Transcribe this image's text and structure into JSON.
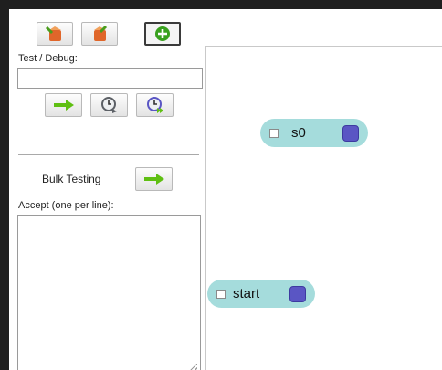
{
  "toolbar": {
    "buttons": [
      {
        "name": "save-file-icon",
        "color": "#e0662a"
      },
      {
        "name": "open-file-icon",
        "color": "#e0662a"
      },
      {
        "name": "add-state-icon",
        "color": "#39a11e"
      }
    ]
  },
  "debug": {
    "label": "Test / Debug:",
    "input_value": "",
    "buttons": [
      "run-arrow-icon",
      "step-clock-icon",
      "fast-forward-clock-icon"
    ]
  },
  "bulk": {
    "label": "Bulk Testing",
    "accept_label": "Accept (one per line):",
    "accept_value": ""
  },
  "states": [
    {
      "label": "s0",
      "checked": false
    },
    {
      "label": "start",
      "checked": false
    }
  ],
  "colors": {
    "state_fill": "#a5dcdc",
    "state_handle": "#5a56c4",
    "arrow_green": "#5fbf12"
  }
}
